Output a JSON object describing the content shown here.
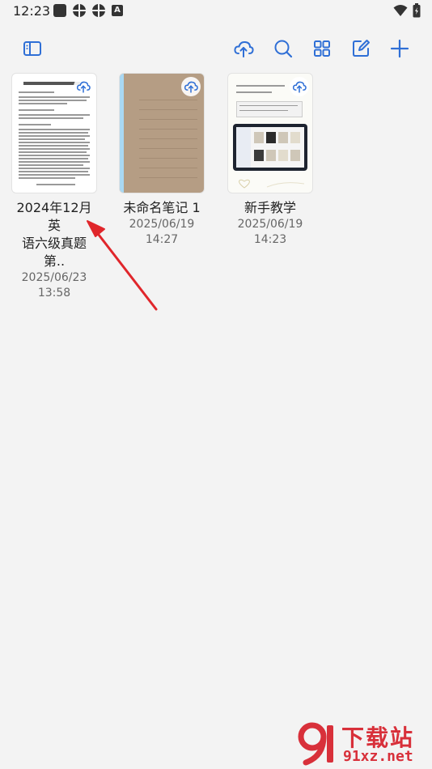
{
  "status_bar": {
    "time": "12:23",
    "left_icons": [
      "notification-square-icon",
      "app-icon",
      "app-icon",
      "keyboard-a-icon"
    ],
    "a_glyph": "A",
    "right_icons": [
      "wifi-icon",
      "battery-icon"
    ]
  },
  "toolbar": {
    "icons": [
      "sidebar-toggle-icon",
      "cloud-sync-icon",
      "search-icon",
      "grid-view-icon",
      "edit-icon",
      "plus-icon"
    ],
    "accent": "#2f6fd6"
  },
  "notebooks": [
    {
      "title_line1": "2024年12月英",
      "title_line2": "语六级真题第..",
      "date": "2025/06/23",
      "time": "13:58",
      "cover": "document"
    },
    {
      "title_line1": "未命名笔记 1",
      "title_line2": "",
      "date": "2025/06/19",
      "time": "14:27",
      "cover": "kraft"
    },
    {
      "title_line1": "新手教学",
      "title_line2": "",
      "date": "2025/06/19",
      "time": "14:23",
      "cover": "tutorial"
    }
  ],
  "annotation": {
    "arrow_color": "#e0262b"
  },
  "watermark": {
    "text": "下载站",
    "url": "91xz.net",
    "color": "#d8303a"
  }
}
